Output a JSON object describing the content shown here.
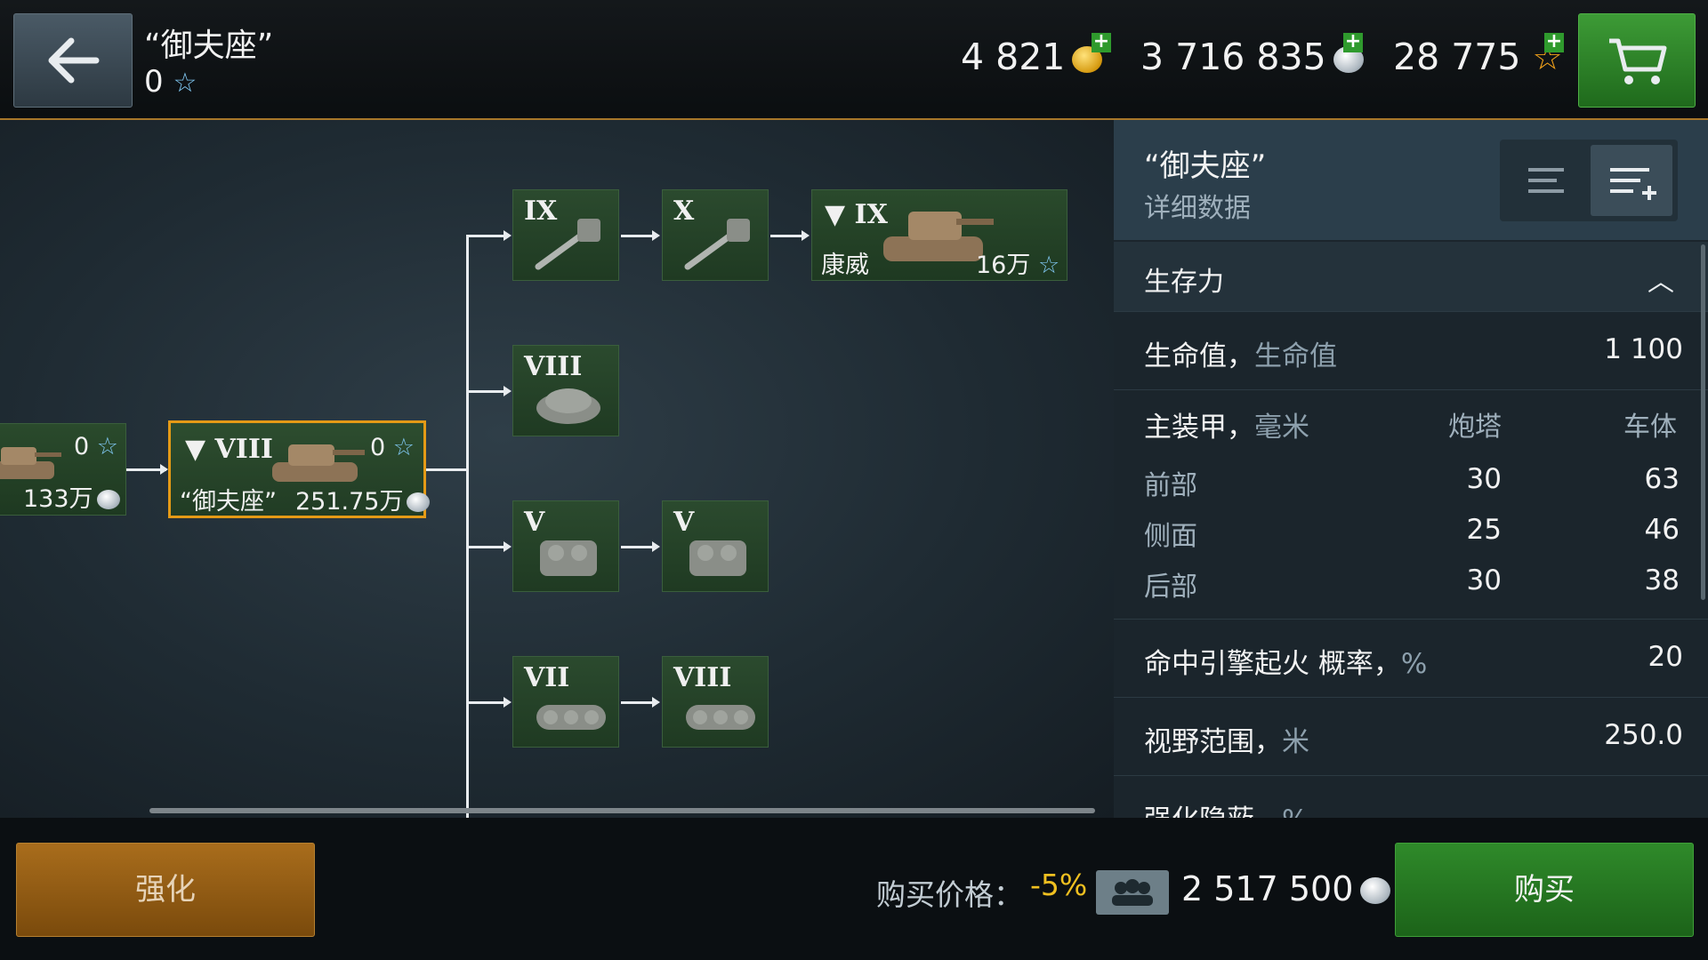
{
  "header": {
    "tank_name": "“御夫座”",
    "tank_xp": "0",
    "gold": "4 821",
    "silver": "3 716 835",
    "free_xp": "28 775"
  },
  "tree": {
    "prev_vehicle": {
      "xp": "0",
      "price": "133万"
    },
    "current_vehicle": {
      "tier": "VIII",
      "name": "“御夫座”",
      "xp": "0",
      "price": "251.75万"
    },
    "next_vehicle": {
      "tier": "IX",
      "name": "康威",
      "xp_cost": "16万"
    },
    "modules": {
      "gun1": {
        "tier": "IX",
        "icon": "gun-icon"
      },
      "gun2": {
        "tier": "X",
        "icon": "gun-icon"
      },
      "turret": {
        "tier": "VIII",
        "icon": "turret-icon"
      },
      "engine1": {
        "tier": "V",
        "icon": "engine-icon"
      },
      "engine2": {
        "tier": "V",
        "icon": "engine-icon"
      },
      "tracks1": {
        "tier": "VII",
        "icon": "tracks-icon"
      },
      "tracks2": {
        "tier": "VIII",
        "icon": "tracks-icon"
      }
    }
  },
  "panel": {
    "title": "“御夫座”",
    "subtitle": "详细数据",
    "section": "生存力",
    "hp_label": "生命值，",
    "hp_unit": "生命值",
    "hp_value": "1 100",
    "armor_label": "主装甲，",
    "armor_unit": "毫米",
    "armor_col_turret": "炮塔",
    "armor_col_hull": "车体",
    "armor_rows": [
      {
        "label": "前部",
        "turret": "30",
        "hull": "63"
      },
      {
        "label": "侧面",
        "turret": "25",
        "hull": "46"
      },
      {
        "label": "后部",
        "turret": "30",
        "hull": "38"
      }
    ],
    "fire_label": "命中引擎起火 概率，",
    "fire_unit": "%",
    "fire_value": "20",
    "view_label": "视野范围，",
    "view_unit": "米",
    "view_value": "250.0",
    "camo_label": "强化隐蔽，",
    "camo_unit": "%"
  },
  "footer": {
    "upgrade_label": "强化",
    "price_label": "购买价格：",
    "discount": "-5%",
    "price_value": "2 517 500",
    "buy_label": "购买"
  },
  "colors": {
    "accent_orange": "#e49a16",
    "buy_green": "#2f8a2a",
    "upgrade_orange": "#a96d1c"
  }
}
